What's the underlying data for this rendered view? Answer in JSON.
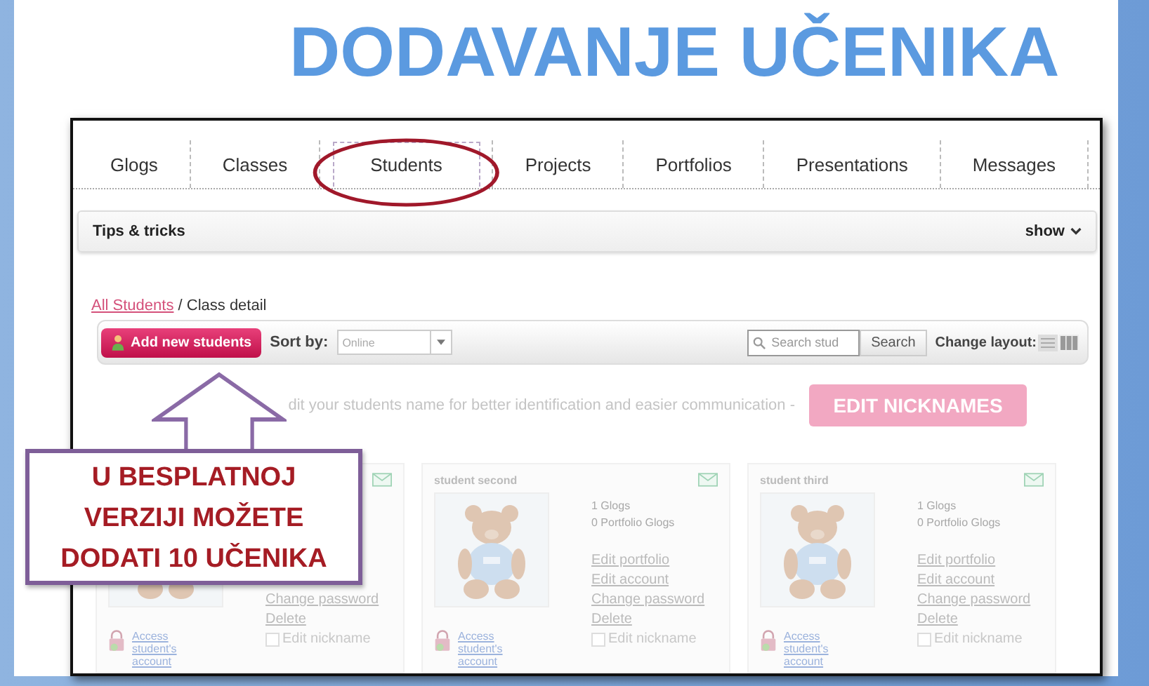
{
  "title": "DODAVANJE UČENIKA",
  "tabs": [
    {
      "label": "Glogs",
      "selected": false,
      "circled": false
    },
    {
      "label": "Classes",
      "selected": false,
      "circled": false
    },
    {
      "label": "Students",
      "selected": true,
      "circled": true
    },
    {
      "label": "Projects",
      "selected": false,
      "circled": false
    },
    {
      "label": "Portfolios",
      "selected": false,
      "circled": false
    },
    {
      "label": "Presentations",
      "selected": false,
      "circled": false
    },
    {
      "label": "Messages",
      "selected": false,
      "circled": false
    }
  ],
  "tips": {
    "label": "Tips & tricks",
    "toggle": "show"
  },
  "breadcrumb": {
    "link": "All Students",
    "current": "/ Class detail"
  },
  "toolbar": {
    "add_button": "Add new students",
    "sort_label": "Sort by:",
    "sort_value": "Online",
    "search_placeholder": "Search stud",
    "search_button": "Search",
    "layout_label": "Change layout:"
  },
  "hint": {
    "text": "dit your students name for better identification and easier communication -",
    "button": "EDIT NICKNAMES"
  },
  "students": [
    {
      "links": [
        "Change password",
        "Delete"
      ],
      "nickname_label": "Edit nickname",
      "nickname_checked": false,
      "access": "Access student's account"
    },
    {
      "name": "student second",
      "stats": [
        "1 Glogs",
        "0 Portfolio Glogs"
      ],
      "links": [
        "Edit portfolio",
        "Edit account",
        "Change password",
        "Delete"
      ],
      "nickname_label": "Edit nickname",
      "nickname_checked": false,
      "access": "Access student's account"
    },
    {
      "name": "student third",
      "stats": [
        "1 Glogs",
        "0 Portfolio Glogs"
      ],
      "links": [
        "Edit portfolio",
        "Edit account",
        "Change password",
        "Delete"
      ],
      "nickname_label": "Edit nickname",
      "nickname_checked": false,
      "access": "Access student's account"
    }
  ],
  "callout": {
    "lines": [
      "U BESPLATNOJ",
      "VERZIJI MOŽETE",
      "DODATI 10 UČENIKA"
    ]
  }
}
